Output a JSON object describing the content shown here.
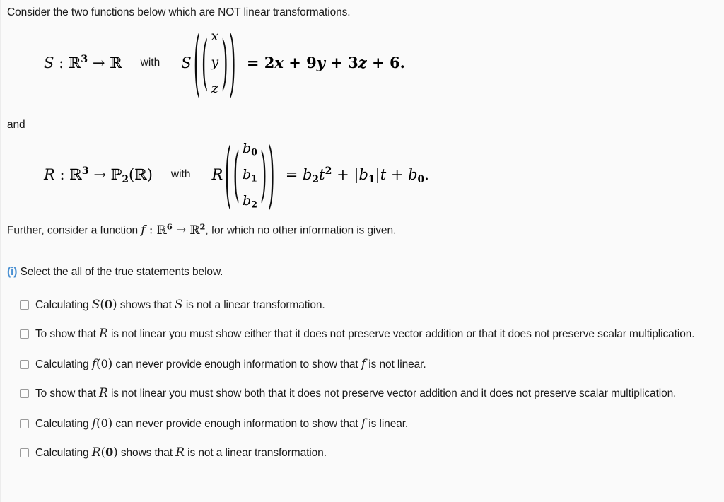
{
  "intro": {
    "text": "Consider the two functions below which are NOT linear transformations."
  },
  "equation_s": {
    "name": "S",
    "domain": "R",
    "domain_exp": "3",
    "codomain": "R",
    "with_label": "with",
    "func_label": "S",
    "vector": [
      "x",
      "y",
      "z"
    ],
    "equals": "=",
    "rhs": "2x + 9y + 3z + 6.",
    "rhs_terms": [
      "2x",
      "+",
      "9y",
      "+",
      "3z",
      "+",
      "6."
    ]
  },
  "conjunction": {
    "text": "and"
  },
  "equation_r": {
    "name": "R",
    "domain": "R",
    "domain_exp": "3",
    "codomain": "P",
    "codomain_sub": "2",
    "codomain_arg": "(R)",
    "with_label": "with",
    "func_label": "R",
    "vector": [
      "b0",
      "b1",
      "b2"
    ],
    "equals": "=",
    "rhs": "b2 t^2 + |b1| t + b0."
  },
  "further": {
    "prefix": "Further, consider a function",
    "func": "f",
    "colon": ":",
    "domain": "R",
    "domain_exp": "6",
    "arrow": "→",
    "codomain": "R",
    "codomain_exp": "2",
    "suffix": ", for which no other information is given."
  },
  "question": {
    "marker": "(i)",
    "marker_color": "#4a90d2",
    "text": "Select the all of the true statements below."
  },
  "options": [
    {
      "id": "option-s-zero-not-linear",
      "checked": false,
      "lines": [
        "Calculating S(0) shows that S is not a linear transformation."
      ],
      "layout": "nowrap"
    },
    {
      "id": "option-r-either-addition-or-scalar",
      "checked": false,
      "lines": [
        "To show that R is not linear you must show either that it does not preserve vector addition or that it does not preserve scalar multiplication."
      ],
      "layout": "wrap"
    },
    {
      "id": "option-f-zero-never-show-not-linear",
      "checked": false,
      "lines": [
        "Calculating f(0) can never provide enough information to show that f is not linear."
      ],
      "layout": "nowrap"
    },
    {
      "id": "option-r-both-addition-and-scalar",
      "checked": false,
      "lines": [
        "To show that R is not linear you must show both that it does not preserve vector addition and it does not preserve scalar multiplication."
      ],
      "layout": "wrap"
    },
    {
      "id": "option-f-zero-never-show-linear",
      "checked": false,
      "lines": [
        "Calculating f(0) can never provide enough information to show that f is linear."
      ],
      "layout": "nowrap"
    },
    {
      "id": "option-r-zero-not-linear",
      "checked": false,
      "lines": [
        "Calculating R(0) shows that R is not a linear transformation."
      ],
      "layout": "nowrap"
    }
  ],
  "option_fragments": {
    "calculating": "Calculating",
    "shows_that": "shows that",
    "is_not_linear_transformation": "is not a linear transformation.",
    "to_show_that": "To show that",
    "is_not_linear_either": "is not linear you must show either that it does not preserve vector addition or that it does not preserve scalar multiplication.",
    "is_not_linear_both": "is not linear you must show both that it does not preserve vector addition and it does not preserve scalar multiplication.",
    "can_never_not_linear": "can never provide enough information to show that",
    "is_not_linear_end": "is not linear.",
    "is_linear_end": "is linear."
  },
  "theme": {
    "background": "#fafafa",
    "text": "#1a1a1a",
    "accent": "#4a90d2",
    "checkbox_border": "#9a9a9a"
  }
}
